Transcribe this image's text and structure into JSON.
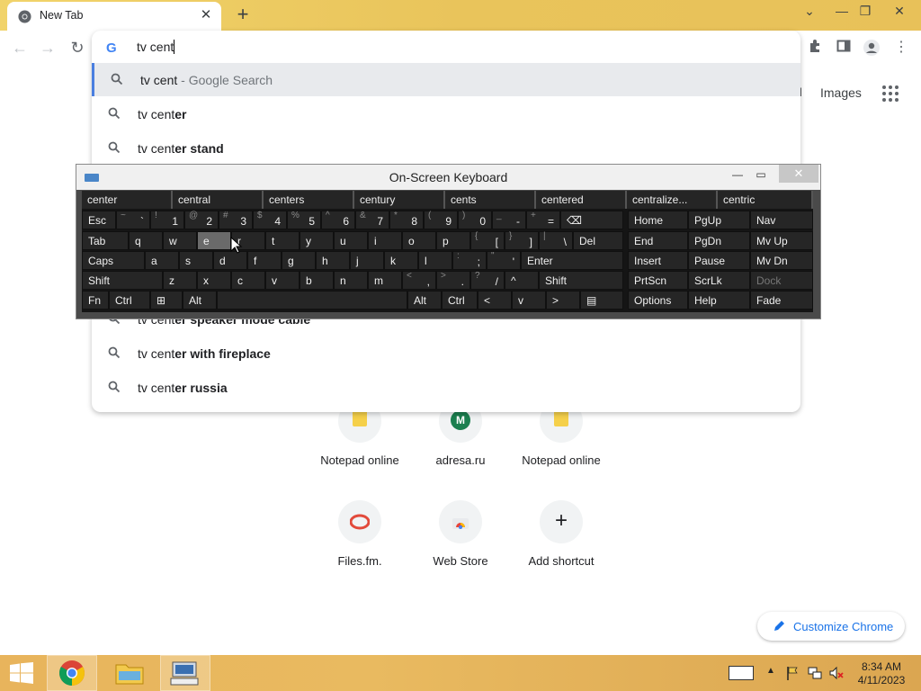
{
  "browser": {
    "tab_title": "New Tab",
    "tab_close": "✕",
    "new_tab": "+"
  },
  "omnibox": {
    "query": "tv cent",
    "suggestions": [
      {
        "prefix": "tv cent",
        "bold": "",
        "extra": " - Google Search"
      },
      {
        "prefix": "tv cent",
        "bold": "er",
        "extra": ""
      },
      {
        "prefix": "tv cent",
        "bold": "er stand",
        "extra": ""
      },
      {
        "prefix": "tv cent",
        "bold": "er speaker mode cable",
        "extra": ""
      },
      {
        "prefix": "tv cent",
        "bold": "er with fireplace",
        "extra": ""
      },
      {
        "prefix": "tv cent",
        "bold": "er russia",
        "extra": ""
      }
    ]
  },
  "page": {
    "gmail_partial": "il",
    "images_link": "Images",
    "shortcuts": [
      {
        "label": "Notepad online",
        "icon": "notepad-icon"
      },
      {
        "label": "adresa.ru",
        "icon": "m-letter-icon",
        "letter": "M"
      },
      {
        "label": "Notepad online",
        "icon": "notepad-icon"
      },
      {
        "label": "Files.fm.",
        "icon": "files-fm-icon"
      },
      {
        "label": "Web Store",
        "icon": "web-store-icon"
      },
      {
        "label": "Add shortcut",
        "icon": "plus-icon"
      }
    ],
    "customize_label": "Customize Chrome"
  },
  "osk": {
    "title": "On-Screen Keyboard",
    "predictions": [
      "center",
      "central",
      "centers",
      "century",
      "cents",
      "centered",
      "centralize...",
      "centric"
    ],
    "row1": [
      {
        "m": "Esc"
      },
      {
        "sh": "~",
        "mn": "`"
      },
      {
        "sh": "!",
        "mn": "1"
      },
      {
        "sh": "@",
        "mn": "2"
      },
      {
        "sh": "#",
        "mn": "3"
      },
      {
        "sh": "$",
        "mn": "4"
      },
      {
        "sh": "%",
        "mn": "5"
      },
      {
        "sh": "^",
        "mn": "6"
      },
      {
        "sh": "&",
        "mn": "7"
      },
      {
        "sh": "*",
        "mn": "8"
      },
      {
        "sh": "(",
        "mn": "9"
      },
      {
        "sh": ")",
        "mn": "0"
      },
      {
        "sh": "_",
        "mn": "-"
      },
      {
        "sh": "+",
        "mn": "="
      },
      {
        "m": "⌫"
      }
    ],
    "row2": [
      {
        "m": "Tab"
      },
      {
        "m": "q"
      },
      {
        "m": "w"
      },
      {
        "m": "e"
      },
      {
        "m": "r"
      },
      {
        "m": "t"
      },
      {
        "m": "y"
      },
      {
        "m": "u"
      },
      {
        "m": "i"
      },
      {
        "m": "o"
      },
      {
        "m": "p"
      },
      {
        "sh": "{",
        "mn": "["
      },
      {
        "sh": "}",
        "mn": "]"
      },
      {
        "sh": "|",
        "mn": "\\"
      },
      {
        "m": "Del"
      }
    ],
    "row3": [
      {
        "m": "Caps"
      },
      {
        "m": "a"
      },
      {
        "m": "s"
      },
      {
        "m": "d"
      },
      {
        "m": "f"
      },
      {
        "m": "g"
      },
      {
        "m": "h"
      },
      {
        "m": "j"
      },
      {
        "m": "k"
      },
      {
        "m": "l"
      },
      {
        "sh": ":",
        "mn": ";"
      },
      {
        "sh": "\"",
        "mn": "'"
      },
      {
        "m": "Enter"
      }
    ],
    "row4": [
      {
        "m": "Shift"
      },
      {
        "m": "z"
      },
      {
        "m": "x"
      },
      {
        "m": "c"
      },
      {
        "m": "v"
      },
      {
        "m": "b"
      },
      {
        "m": "n"
      },
      {
        "m": "m"
      },
      {
        "sh": "<",
        "mn": ","
      },
      {
        "sh": ">",
        "mn": "."
      },
      {
        "sh": "?",
        "mn": "/"
      },
      {
        "m": "^"
      },
      {
        "m": "Shift"
      }
    ],
    "row5": [
      {
        "m": "Fn"
      },
      {
        "m": "Ctrl"
      },
      {
        "m": "⊞"
      },
      {
        "m": "Alt"
      },
      {
        "m": ""
      },
      {
        "m": "Alt"
      },
      {
        "m": "Ctrl"
      },
      {
        "m": "<"
      },
      {
        "m": "v"
      },
      {
        "m": ">"
      },
      {
        "m": "▤"
      }
    ],
    "nav_keys": [
      [
        "Home",
        "PgUp",
        "Nav"
      ],
      [
        "End",
        "PgDn",
        "Mv Up"
      ],
      [
        "Insert",
        "Pause",
        "Mv Dn"
      ],
      [
        "PrtScn",
        "ScrLk",
        "Dock"
      ],
      [
        "Options",
        "Help",
        "Fade"
      ]
    ]
  },
  "taskbar": {
    "time": "8:34 AM",
    "date": "4/11/2023"
  }
}
